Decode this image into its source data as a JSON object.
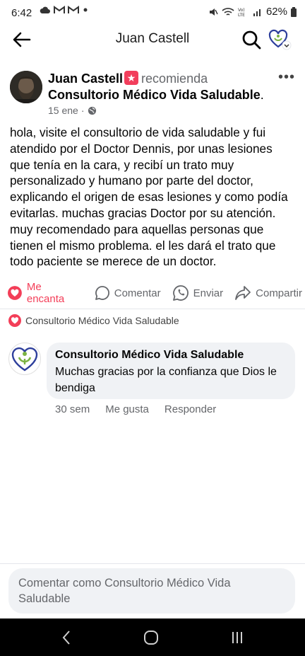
{
  "status_bar": {
    "time": "6:42",
    "battery": "62%",
    "icons": [
      "cloud-icon",
      "gmail-icon",
      "gmail-icon",
      "dot-icon",
      "mute-icon",
      "wifi-icon",
      "volte-icon",
      "signal-icon",
      "battery-icon"
    ]
  },
  "header": {
    "title": "Juan Castell"
  },
  "post": {
    "author": "Juan Castell",
    "verb": "recomienda",
    "page_name": "Consultorio Médico Vida Saludable",
    "page_suffix": ".",
    "date": "15 ene",
    "dot": "·",
    "body": "hola, visite el consultorio de vida saludable y fui atendido por el Doctor Dennis, por unas lesiones que tenía en la cara, y recibí un trato muy personalizado y  humano por parte del doctor, explicando el origen de esas lesiones y como podía evitarlas. muchas gracias Doctor por su atención. muy recomendado para aquellas personas que tienen el mismo problema. el les dará el trato que todo paciente se merece de un doctor.",
    "more": "•••"
  },
  "actions": {
    "love": "Me encanta",
    "comment": "Comentar",
    "send": "Enviar",
    "share": "Compartir"
  },
  "reactions": {
    "reacted_by": "Consultorio Médico Vida Saludable"
  },
  "comment": {
    "author": "Consultorio Médico Vida Saludable",
    "text": "Muchas gracias por la confianza que Dios le bendiga",
    "time": "30 sem",
    "like": "Me gusta",
    "reply": "Responder"
  },
  "composer": {
    "placeholder": "Comentar como Consultorio Médico Vida Saludable"
  },
  "colors": {
    "love": "#f33e58",
    "muted": "#65676b",
    "bubble": "#f0f2f5",
    "logo_blue": "#2e3f9c",
    "logo_green": "#7cb342"
  }
}
